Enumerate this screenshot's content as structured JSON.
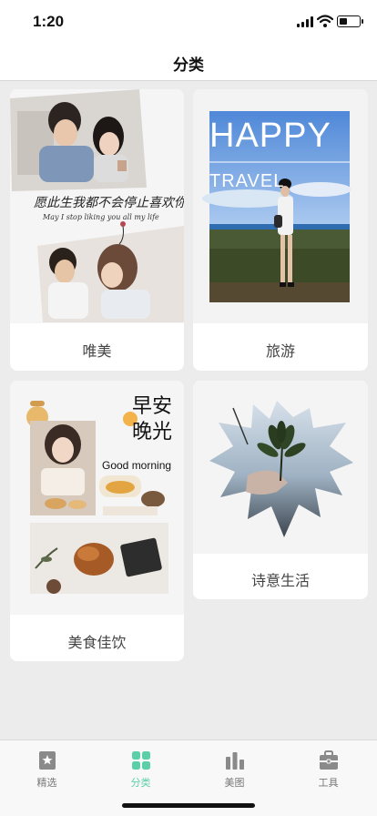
{
  "status_bar": {
    "time": "1:20",
    "battery_level": 0.4,
    "icons": [
      "cellular-signal-icon",
      "wifi-icon",
      "battery-icon"
    ]
  },
  "nav": {
    "title": "分类"
  },
  "categories": [
    {
      "label": "唯美",
      "photo_text_line1": "愿此生我都不会停止喜欢你",
      "photo_text_line2": "May I stop liking you all my life"
    },
    {
      "label": "旅游",
      "photo_text_line1": "HAPPY",
      "photo_text_line2": "TRAVEL"
    },
    {
      "label": "美食佳饮",
      "photo_text_line1": "早安",
      "photo_text_line2": "晚光",
      "photo_text_line3": "Good morning"
    },
    {
      "label": "诗意生活"
    }
  ],
  "tabs": [
    {
      "label": "精选",
      "icon": "star-badge-icon",
      "active": false
    },
    {
      "label": "分类",
      "icon": "grid-icon",
      "active": true
    },
    {
      "label": "美图",
      "icon": "bar-chart-icon",
      "active": false
    },
    {
      "label": "工具",
      "icon": "toolbox-icon",
      "active": false
    }
  ],
  "colors": {
    "accent": "#5dcfa8",
    "inactive": "#777777",
    "background": "#ececec"
  }
}
